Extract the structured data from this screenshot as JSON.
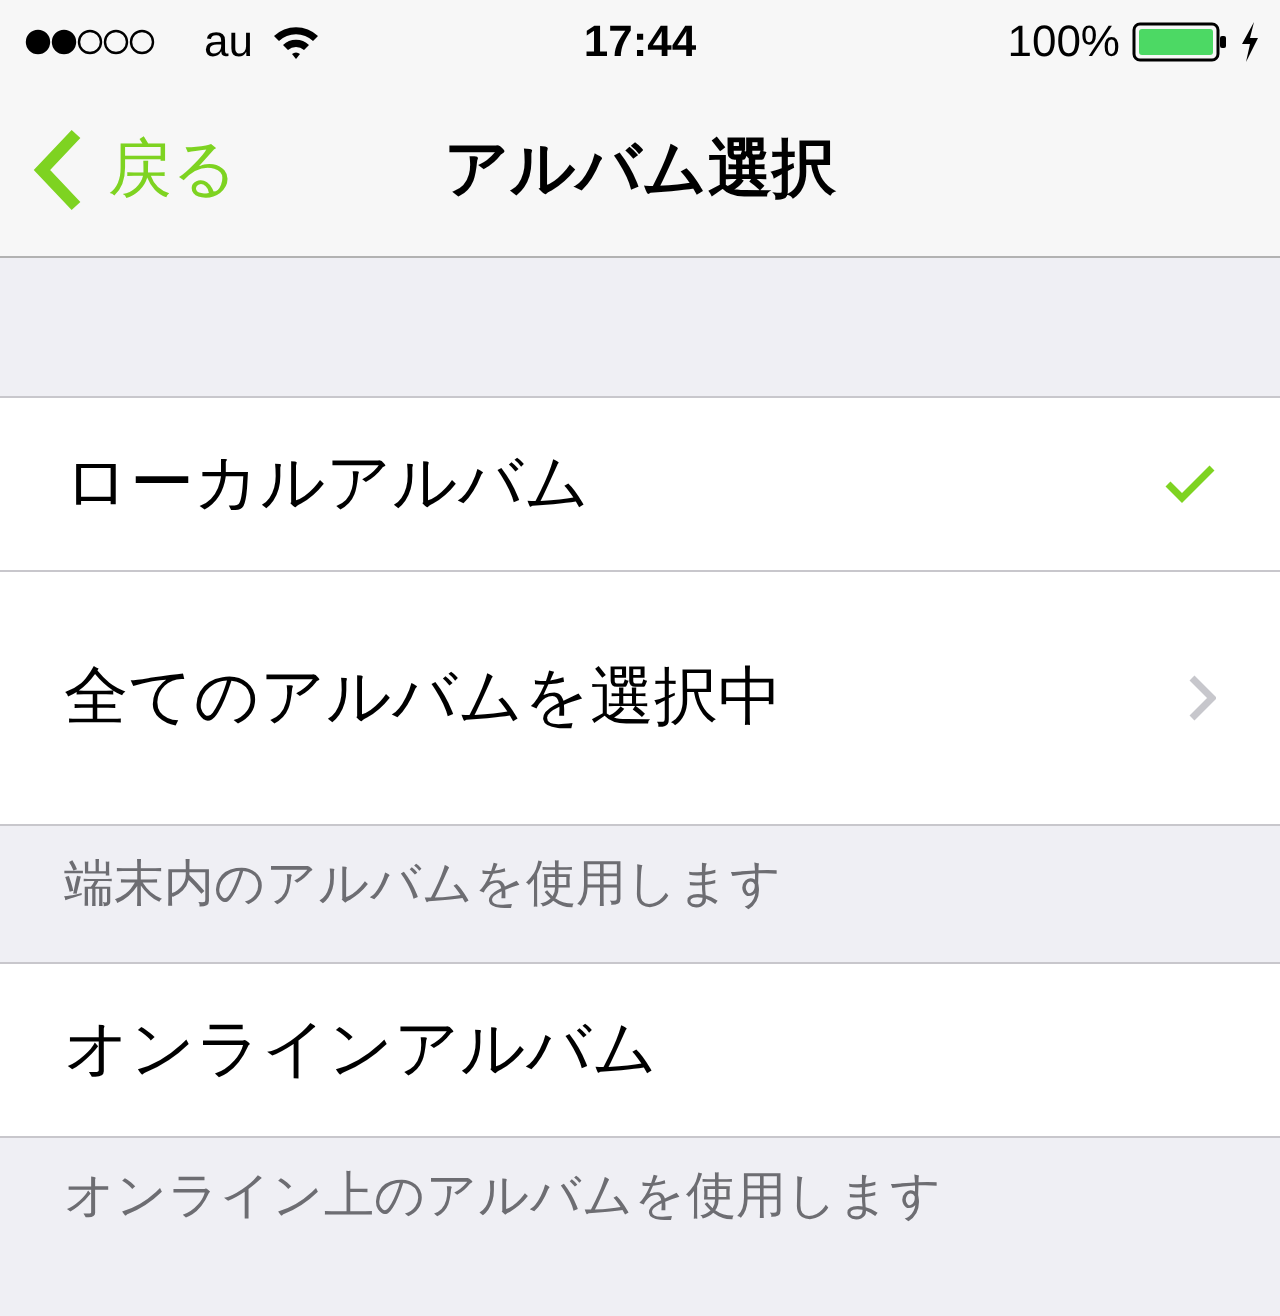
{
  "status_bar": {
    "carrier": "au",
    "time": "17:44",
    "battery": "100%"
  },
  "nav": {
    "back": "戻る",
    "title": "アルバム選択"
  },
  "sections": [
    {
      "rows": [
        {
          "label": "ローカルアルバム",
          "kind": "check",
          "checked": true
        },
        {
          "label": "全てのアルバムを選択中",
          "kind": "disclosure"
        }
      ],
      "footer": "端末内のアルバムを使用します"
    },
    {
      "rows": [
        {
          "label": "オンラインアルバム",
          "kind": "plain"
        }
      ],
      "footer": "オンライン上のアルバムを使用します"
    }
  ]
}
